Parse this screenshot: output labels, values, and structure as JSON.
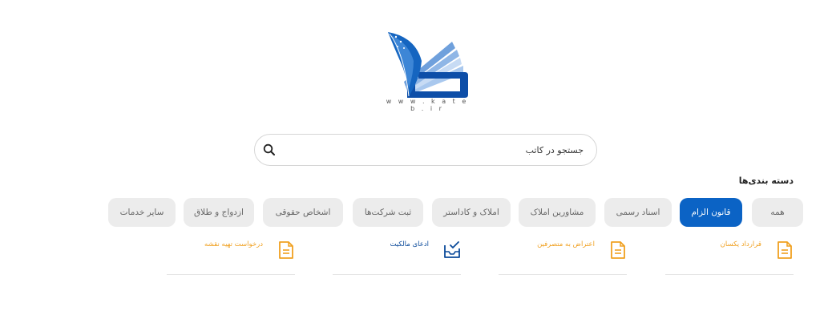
{
  "logo": {
    "url_text": "w w w . k a t e b . i r"
  },
  "search": {
    "placeholder": "جستجو در کاتب"
  },
  "categories": {
    "title": "دسته بندی‌ها",
    "tabs": [
      {
        "label": "همه"
      },
      {
        "label": "قانون الزام",
        "active": true
      },
      {
        "label": "اسناد رسمی"
      },
      {
        "label": "مشاورین املاک"
      },
      {
        "label": "املاک و کاداستر"
      },
      {
        "label": "ثبت شرکت‌ها"
      },
      {
        "label": "اشخاص حقوقی"
      },
      {
        "label": "ازدواج و طلاق"
      },
      {
        "label": "سایر خدمات"
      }
    ]
  },
  "services": [
    {
      "label": "قرارداد یکسان",
      "icon": "document-icon"
    },
    {
      "label": "اعتراض به متصرفین",
      "icon": "document-icon"
    },
    {
      "label": "ادعای مالکیت",
      "icon": "inbox-check-icon"
    },
    {
      "label": "درخواست تهیه نقشه",
      "icon": "document-icon"
    }
  ],
  "colors": {
    "accent": "#0b63c5",
    "service_orange": "#f0a020",
    "service_blue": "#0b4a9a",
    "tab_bg": "#ececec"
  }
}
